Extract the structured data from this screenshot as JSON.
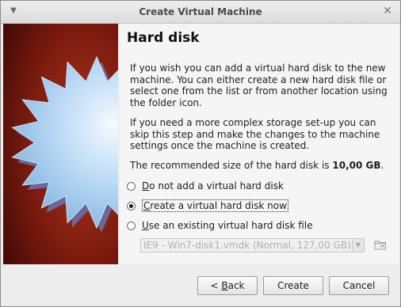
{
  "window": {
    "title": "Create Virtual Machine",
    "menu_icon": "chevron-down-icon",
    "close_icon": "close-icon"
  },
  "page": {
    "heading": "Hard disk",
    "paragraph1": "If you wish you can add a virtual hard disk to the new machine. You can either create a new hard disk file or select one from the list or from another location using the folder icon.",
    "paragraph2": "If you need a more complex storage set-up you can skip this step and make the changes to the machine settings once the machine is created.",
    "paragraph3_prefix": "The recommended size of the hard disk is ",
    "recommended_size": "10,00 GB",
    "paragraph3_suffix": "."
  },
  "options": {
    "no_disk": {
      "mnemonic": "D",
      "rest": "o not add a virtual hard disk",
      "selected": false
    },
    "create_disk": {
      "mnemonic": "C",
      "rest": "reate a virtual hard disk now",
      "selected": true
    },
    "existing_disk": {
      "mnemonic": "U",
      "rest": "se an existing virtual hard disk file",
      "selected": false
    }
  },
  "existing_disk_select": {
    "value": "IE9 - Win7-disk1.vmdk (Normal, 127,00 GB)",
    "enabled": false
  },
  "buttons": {
    "back_prefix": "< ",
    "back_mnemonic": "B",
    "back_rest": "ack",
    "create": "Create",
    "cancel": "Cancel"
  },
  "colors": {
    "banner_bg": "#7a1a0e",
    "star": "#9fc6ea"
  }
}
